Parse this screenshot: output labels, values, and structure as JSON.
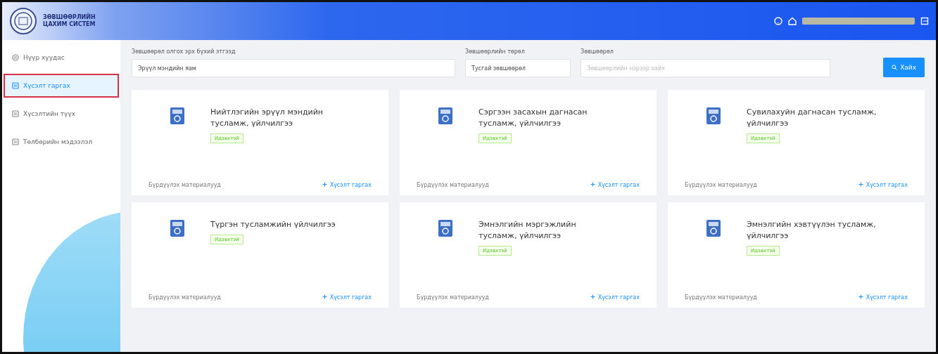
{
  "header": {
    "logo_text": [
      "ЗӨВШӨӨРЛИЙН",
      "ЦАХИМ СИСТЕМ"
    ]
  },
  "sidebar": {
    "items": [
      {
        "label": "Нүүр хуудас",
        "selected": false
      },
      {
        "label": "Хүсэлт гаргах",
        "selected": true
      },
      {
        "label": "Хүсэлтийн түүх",
        "selected": false
      },
      {
        "label": "Төлбөрийн мэдээлэл",
        "selected": false
      }
    ]
  },
  "filters": [
    {
      "kind": "select",
      "label": "Зөвшөөрөл олгох эрх бүхий этгээд",
      "value": "Эрүүл мэндийн яам"
    },
    {
      "kind": "select",
      "label": "Зөвшөөрлийн төрөл",
      "value": "Тусгай зөвшөөрөл"
    },
    {
      "kind": "input",
      "label": "Зөвшөөрөл",
      "placeholder": "Зөвшөөрлийн нэрээр хайх"
    }
  ],
  "search_button": "Хайх",
  "cards": [
    {
      "title": "Нийтлэгийн эрүүл мэндийн тусламж, үйлчилгээ",
      "status": "Идэвхтэй",
      "docs": "Бүрдүүлэх материалууд",
      "action": "Хүсэлт гаргах"
    },
    {
      "title": "Сэргээн засахын дагнасан тусламж, үйлчилгээ",
      "status": "Идэвхтэй",
      "docs": "Бүрдүүлэх материалууд",
      "action": "Хүсэлт гаргах"
    },
    {
      "title": "Сувилахуйн дагнасан тусламж, үйлчилгээ",
      "status": "Идэвхтэй",
      "docs": "Бүрдүүлэх материалууд",
      "action": "Хүсэлт гаргах"
    },
    {
      "title": "Түргэн тусламжийн үйлчилгээ",
      "status": "Идэвхтэй",
      "docs": "Бүрдүүлэх материалууд",
      "action": "Хүсэлт гаргах"
    },
    {
      "title": "Эмнэлгийн мэргэжлийн тусламж, үйлчилгээ",
      "status": "Идэвхтэй",
      "docs": "Бүрдүүлэх материалууд",
      "action": "Хүсэлт гаргах"
    },
    {
      "title": "Эмнэлгийн хэвтүүлэн тусламж, үйлчилгээ",
      "status": "Идэвхтэй",
      "docs": "Бүрдүүлэх материалууд",
      "action": "Хүсэлт гаргах"
    }
  ]
}
